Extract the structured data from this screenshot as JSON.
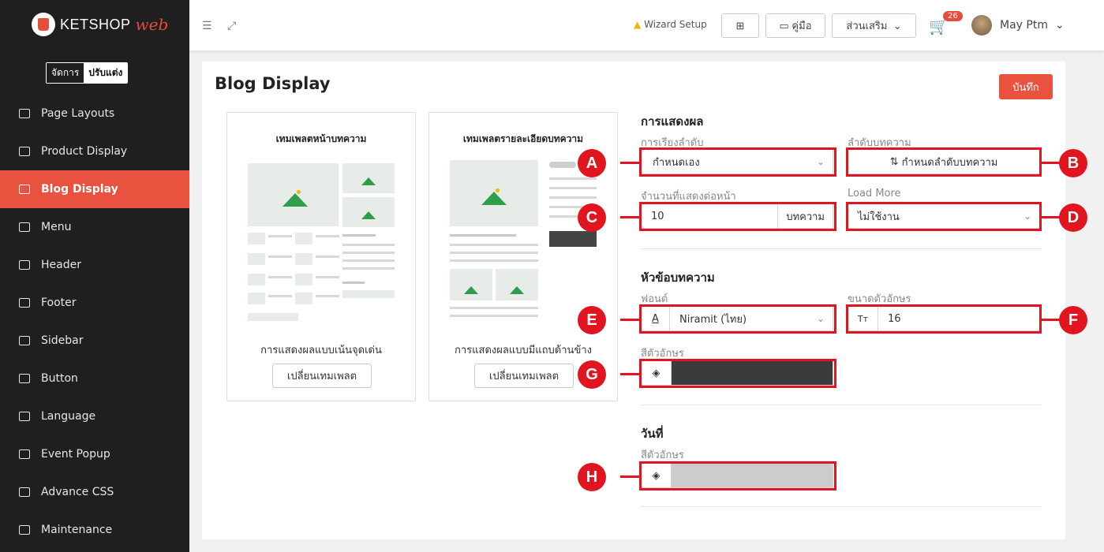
{
  "brand": {
    "name": "KETSHOP",
    "suffix": "web",
    "accent": "#e8523f"
  },
  "mode_toggle": {
    "manage": "จัดการ",
    "customize": "ปรับแต่ง"
  },
  "nav": [
    {
      "label": "Page Layouts",
      "icon": "layout-icon"
    },
    {
      "label": "Product Display",
      "icon": "grid-icon"
    },
    {
      "label": "Blog Display",
      "icon": "blog-icon",
      "active": true
    },
    {
      "label": "Menu",
      "icon": "menu-icon"
    },
    {
      "label": "Header",
      "icon": "header-icon"
    },
    {
      "label": "Footer",
      "icon": "footer-icon"
    },
    {
      "label": "Sidebar",
      "icon": "sidebar-icon"
    },
    {
      "label": "Button",
      "icon": "toggle-icon"
    },
    {
      "label": "Language",
      "icon": "language-icon"
    },
    {
      "label": "Event Popup",
      "icon": "popup-icon"
    },
    {
      "label": "Advance CSS",
      "icon": "css-icon"
    },
    {
      "label": "Maintenance",
      "icon": "bug-icon"
    }
  ],
  "topbar": {
    "wizard": "Wizard Setup",
    "manual": "คู่มือ",
    "addons": "ส่วนเสริม",
    "cart_count": "26",
    "user": "May Ptm"
  },
  "page": {
    "title": "Blog Display",
    "save": "บันทึก"
  },
  "templates": [
    {
      "title": "เทมเพลตหน้าบทความ",
      "caption": "การแสดงผลแบบเน้นจุดเด่น",
      "button": "เปลี่ยนเทมเพลต"
    },
    {
      "title": "เทมเพลตรายละเอียดบทความ",
      "caption": "การแสดงผลแบบมีแถบด้านข้าง",
      "button": "เปลี่ยนเทมเพลต"
    }
  ],
  "display": {
    "title": "การแสดงผล",
    "sort_label": "การเรียงลำดับ",
    "sort_value": "กำหนดเอง",
    "order_label": "ลำดับบทความ",
    "order_button": "กำหนดลำดับบทความ",
    "per_page_label": "จำนวนที่แสดงต่อหน้า",
    "per_page_value": "10",
    "per_page_unit": "บทความ",
    "load_more_label": "Load More",
    "load_more_value": "ไม่ใช้งาน"
  },
  "heading": {
    "title": "หัวข้อบทความ",
    "font_label": "ฟอนต์",
    "font_value": "Niramit (ไทย)",
    "size_label": "ขนาดตัวอักษร",
    "size_value": "16",
    "color_label": "สีตัวอักษร",
    "color_value": "#3b3b3b"
  },
  "date": {
    "title": "วันที่",
    "color_label": "สีตัวอักษร",
    "color_value": "#cccccc"
  },
  "markers": [
    "A",
    "B",
    "C",
    "D",
    "E",
    "F",
    "G",
    "H"
  ],
  "highlight_color": "#e0151f"
}
